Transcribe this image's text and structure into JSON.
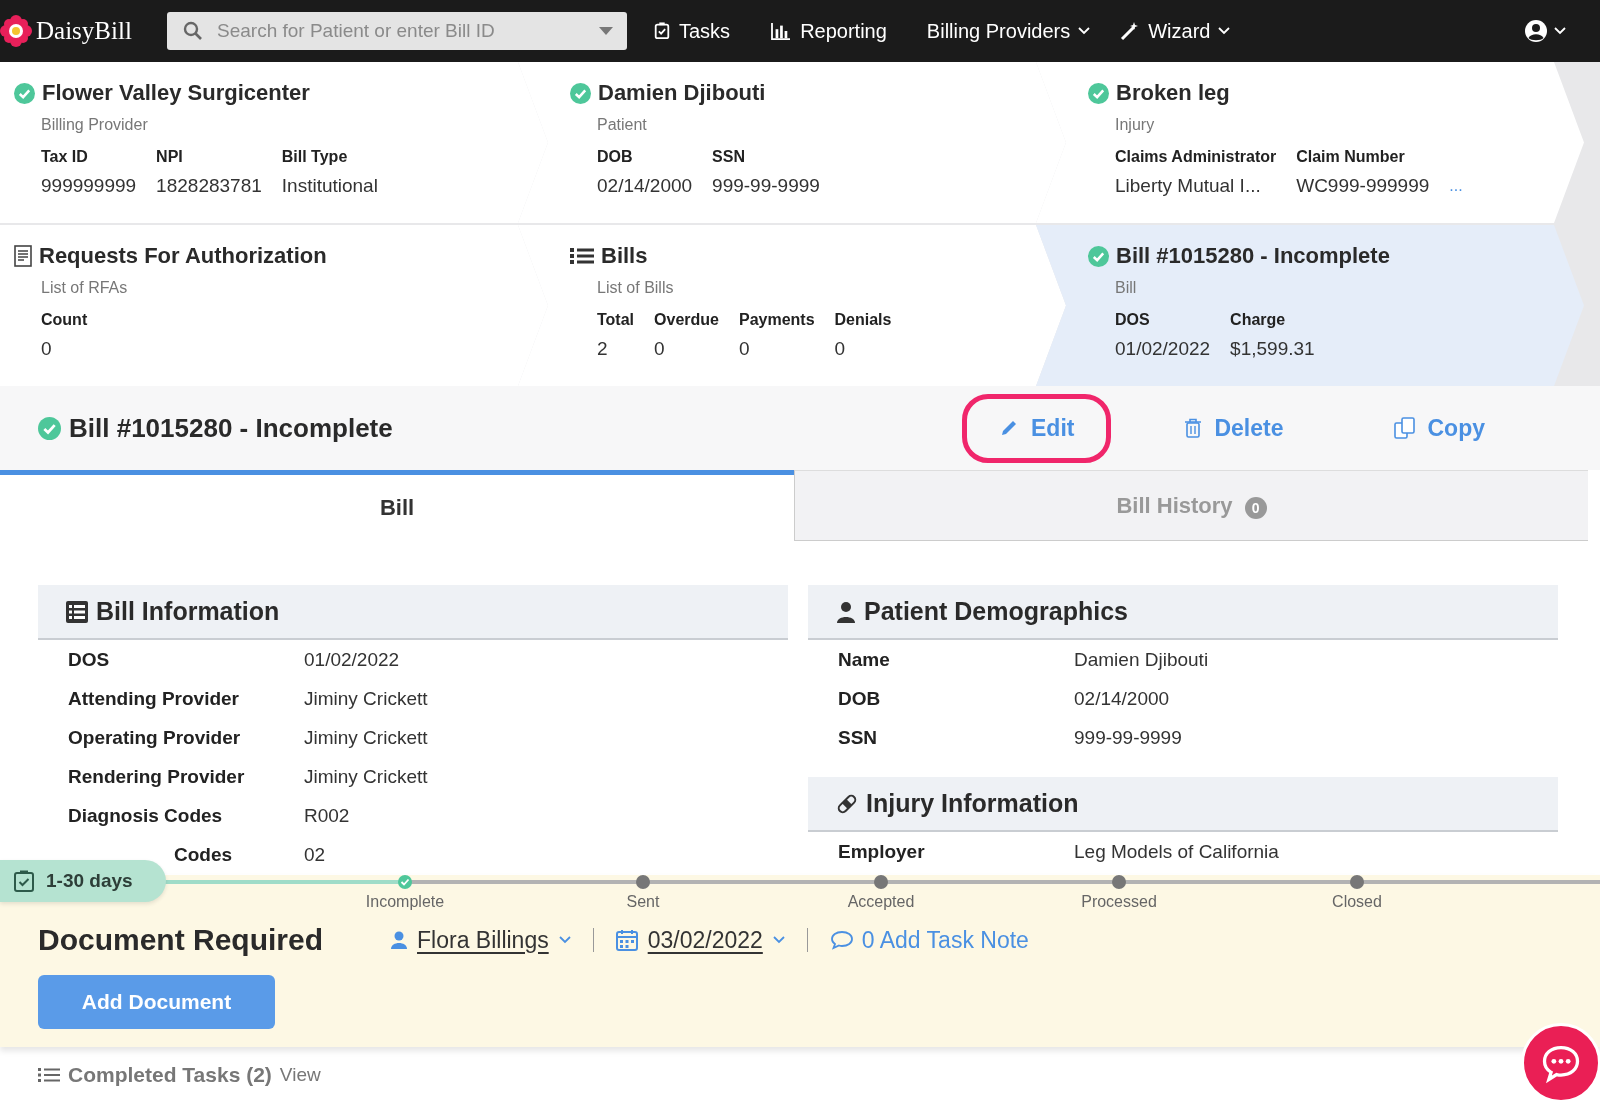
{
  "nav": {
    "logo": "DaisyBill",
    "search": {
      "placeholder": "Search for Patient or enter Bill ID"
    },
    "items": [
      {
        "label": "Tasks",
        "dropdown": false
      },
      {
        "label": "Reporting",
        "dropdown": false
      },
      {
        "label": "Billing Providers",
        "dropdown": true
      },
      {
        "label": "Wizard",
        "dropdown": true
      }
    ]
  },
  "card_rows": [
    [
      {
        "title": "Flower Valley Surgicenter",
        "subtitle": "Billing Provider",
        "selected": false,
        "fields": [
          {
            "label": "Tax ID",
            "value": "999999999"
          },
          {
            "label": "NPI",
            "value": "1828283781"
          },
          {
            "label": "Bill Type",
            "value": "Institutional"
          }
        ]
      },
      {
        "title": "Damien Djibouti",
        "subtitle": "Patient",
        "selected": false,
        "fields": [
          {
            "label": "DOB",
            "value": "02/14/2000"
          },
          {
            "label": "SSN",
            "value": "999-99-9999"
          }
        ]
      },
      {
        "title": "Broken leg",
        "subtitle": "Injury",
        "selected": false,
        "more": "...",
        "fields": [
          {
            "label": "Claims Administrator",
            "value": "Liberty Mutual I..."
          },
          {
            "label": "Claim Number",
            "value": "WC999-999999"
          }
        ]
      }
    ],
    [
      {
        "title": "Requests For Authorization",
        "subtitle": "List of RFAs",
        "selected": false,
        "fields": [
          {
            "label": "Count",
            "value": "0"
          }
        ]
      },
      {
        "title": "Bills",
        "subtitle": "List of Bills",
        "selected": false,
        "fields": [
          {
            "label": "Total",
            "value": "2"
          },
          {
            "label": "Overdue",
            "value": "0"
          },
          {
            "label": "Payments",
            "value": "0"
          },
          {
            "label": "Denials",
            "value": "0"
          }
        ]
      },
      {
        "title": "Bill #1015280 - Incomplete",
        "subtitle": "Bill",
        "selected": true,
        "fields": [
          {
            "label": "DOS",
            "value": "01/02/2022"
          },
          {
            "label": "Charge",
            "value": "$1,599.31"
          }
        ]
      }
    ]
  ],
  "bill_header": {
    "title": "Bill #1015280 - Incomplete",
    "actions": [
      {
        "kind": "edit",
        "label": "Edit",
        "circled": true
      },
      {
        "kind": "delete",
        "label": "Delete",
        "circled": false
      },
      {
        "kind": "copy",
        "label": "Copy",
        "circled": false
      }
    ]
  },
  "tabs": [
    {
      "label": "Bill",
      "selected": true
    },
    {
      "label": "Bill History",
      "selected": false,
      "badge": "0"
    }
  ],
  "sections": {
    "left": [
      {
        "title": "Bill Information",
        "rows": [
          {
            "label": "DOS",
            "value": "01/02/2022"
          },
          {
            "label": "Attending Provider",
            "value": "Jiminy Crickett"
          },
          {
            "label": "Operating Provider",
            "value": "Jiminy Crickett"
          },
          {
            "label": "Rendering Provider",
            "value": "Jiminy Crickett"
          },
          {
            "label": "Diagnosis Codes",
            "value": "R002"
          },
          {
            "label": "Codes",
            "value": "02"
          }
        ]
      }
    ],
    "right": [
      {
        "title": "Patient Demographics",
        "rows": [
          {
            "label": "Name",
            "value": "Damien Djibouti"
          },
          {
            "label": "DOB",
            "value": "02/14/2000"
          },
          {
            "label": "SSN",
            "value": "999-99-9999"
          }
        ]
      },
      {
        "title": "Injury Information",
        "rows": [
          {
            "label": "Employer",
            "value": "Leg Models of California"
          }
        ]
      }
    ]
  },
  "task": {
    "timer": "1-30 days",
    "steps": [
      {
        "label": "Incomplete",
        "done": true
      },
      {
        "label": "Sent",
        "done": false
      },
      {
        "label": "Accepted",
        "done": false
      },
      {
        "label": "Processed",
        "done": false
      },
      {
        "label": "Closed",
        "done": false
      }
    ],
    "title": "Document Required",
    "assignee": "Flora Billings",
    "date": "03/02/2022",
    "note": "0 Add Task Note",
    "button": "Add Document"
  },
  "completed": {
    "label": "Completed Tasks (2)",
    "link": "View"
  }
}
